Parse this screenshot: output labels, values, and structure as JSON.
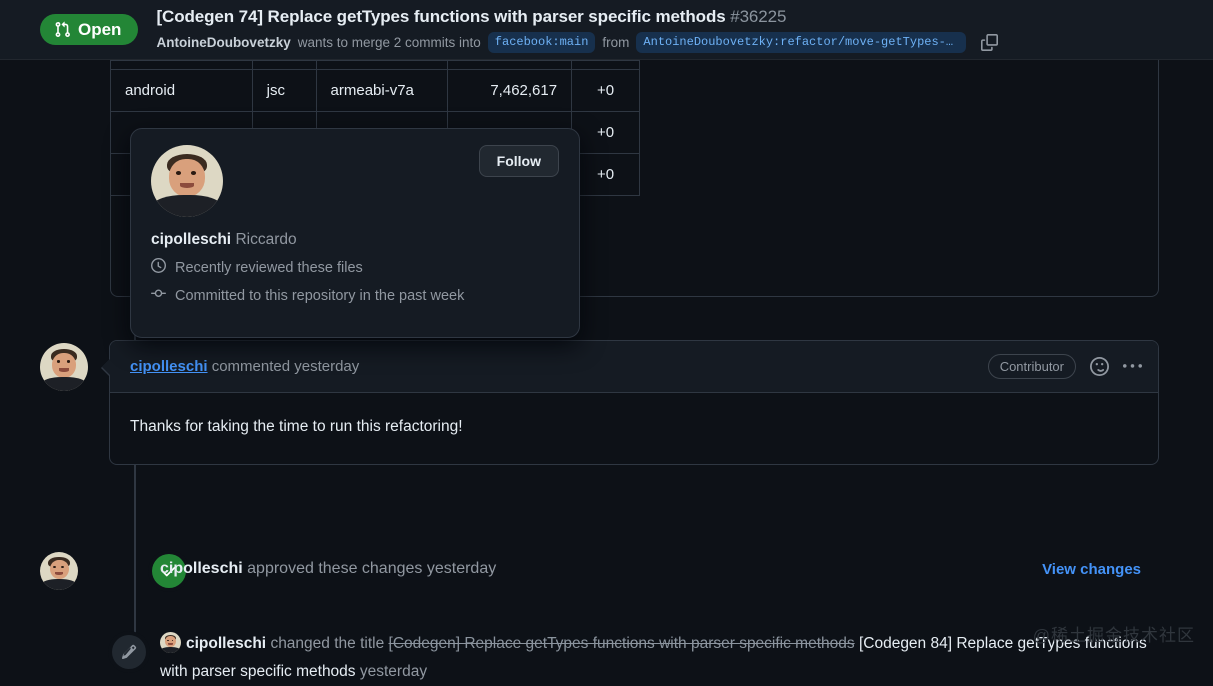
{
  "header": {
    "state_label": "Open",
    "state_icon": "git-pull-request-icon",
    "state_color": "#238636",
    "title": "[Codegen 74] Replace getTypes functions with parser specific methods",
    "pr_number": "#36225",
    "author": "AntoineDoubovetzky",
    "merge_text": "wants to merge 2 commits into",
    "base_branch": "facebook:main",
    "from_label": "from",
    "head_branch": "AntoineDoubovetzky:refactor/move-getTypes-to…",
    "copy_icon": "copy-icon"
  },
  "table": {
    "rows": [
      {
        "platform": "android",
        "engine": "jsc",
        "arch": "armeabi-v7a",
        "size": "7,462,617",
        "delta": "+0"
      },
      {
        "platform": "",
        "engine": "",
        "arch": "",
        "size": "",
        "delta": "+0"
      },
      {
        "platform": "",
        "engine": "",
        "arch": "",
        "size": "",
        "delta": "+0"
      }
    ]
  },
  "hovercard": {
    "follow_label": "Follow",
    "username": "cipolleschi",
    "fullname": "Riccardo",
    "activity": [
      {
        "icon": "clock-icon",
        "text": "Recently reviewed these files"
      },
      {
        "icon": "git-commit-icon",
        "text": "Committed to this repository in the past week"
      }
    ]
  },
  "comment": {
    "author": "cipolleschi",
    "action": "commented yesterday",
    "role_badge": "Contributor",
    "reaction_icon": "smiley-icon",
    "menu_icon": "kebab-menu-icon",
    "body": "Thanks for taking the time to run this refactoring!"
  },
  "approval": {
    "icon": "check-icon",
    "author": "cipolleschi",
    "text": "approved these changes yesterday",
    "link_label": "View changes"
  },
  "title_change": {
    "icon": "pencil-icon",
    "author": "cipolleschi",
    "action": "changed the title",
    "old_title": "[Codegen] Replace getTypes functions with parser specific methods",
    "new_title": "[Codegen 84] Replace getTypes functions with parser specific methods",
    "time": "yesterday"
  },
  "watermark": "@稀土掘金技术社区"
}
